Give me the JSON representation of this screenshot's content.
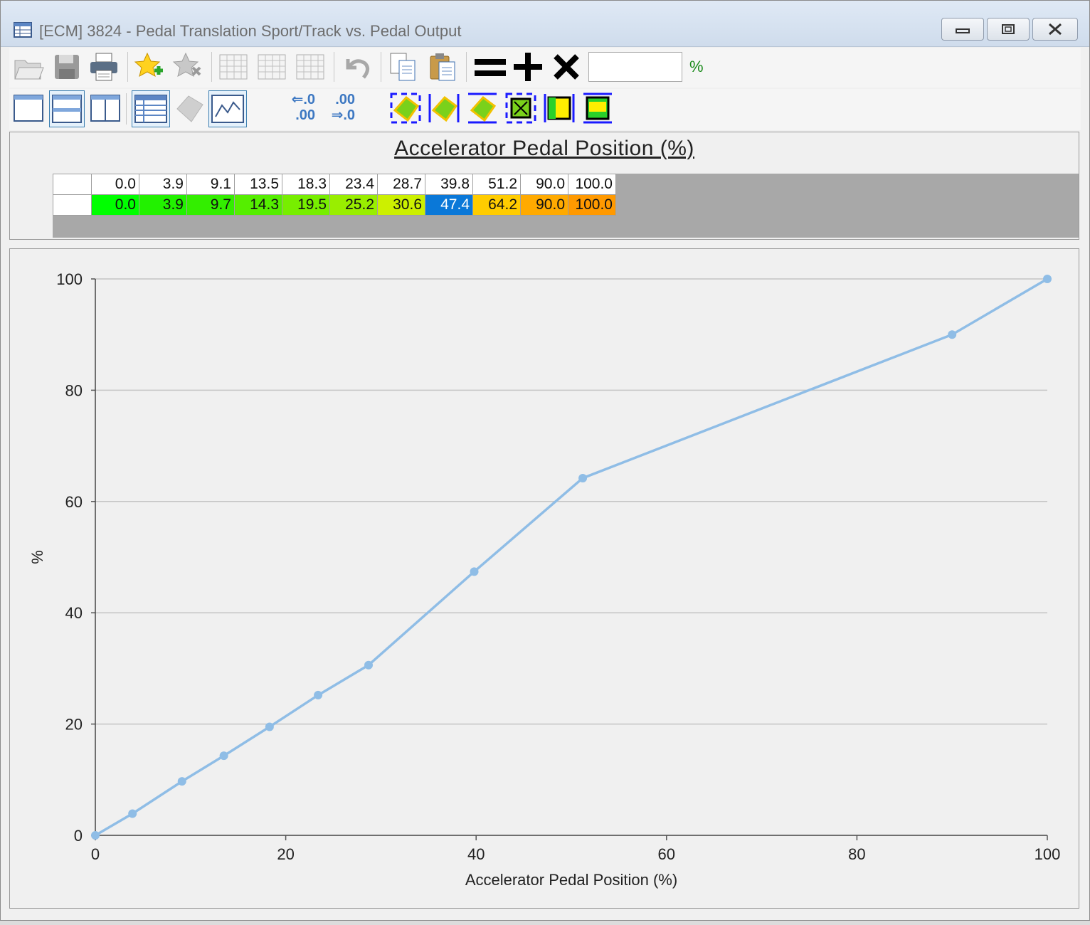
{
  "window": {
    "title": "[ECM] 3824 - Pedal Translation Sport/Track vs. Pedal Output"
  },
  "toolbar": {
    "value_input": "",
    "unit_label": "%",
    "increase_label": ".00",
    "increase_label2": "⇒.0",
    "decrease_label": "⇐.0",
    "decrease_label2": ".00"
  },
  "table": {
    "axis_title": "Accelerator Pedal Position (%)",
    "header": [
      "0.0",
      "3.9",
      "9.1",
      "13.5",
      "18.3",
      "23.4",
      "28.7",
      "39.8",
      "51.2",
      "90.0",
      "100.0"
    ],
    "values": [
      "0.0",
      "3.9",
      "9.7",
      "14.3",
      "19.5",
      "25.2",
      "30.6",
      "47.4",
      "64.2",
      "90.0",
      "100.0"
    ],
    "value_colors": [
      "#00ff00",
      "#22f100",
      "#33ee00",
      "#55ee00",
      "#77ee00",
      "#99ee00",
      "#ccf000",
      "#0a78d8",
      "#ffcc00",
      "#ffaa00",
      "#ff9900"
    ],
    "selected_index": 7
  },
  "chart_data": {
    "type": "line",
    "x": [
      0.0,
      3.9,
      9.1,
      13.5,
      18.3,
      23.4,
      28.7,
      39.8,
      51.2,
      90.0,
      100.0
    ],
    "y": [
      0.0,
      3.9,
      9.7,
      14.3,
      19.5,
      25.2,
      30.6,
      47.4,
      64.2,
      90.0,
      100.0
    ],
    "xlabel": "Accelerator Pedal Position (%)",
    "ylabel": "%",
    "xlim": [
      0,
      100
    ],
    "ylim": [
      0,
      100
    ],
    "xticks": [
      "0",
      "20",
      "40",
      "60",
      "80",
      "100"
    ],
    "yticks": [
      "0",
      "20",
      "40",
      "60",
      "80",
      "100"
    ],
    "grid": "horizontal",
    "line_color": "#8fbde6"
  }
}
